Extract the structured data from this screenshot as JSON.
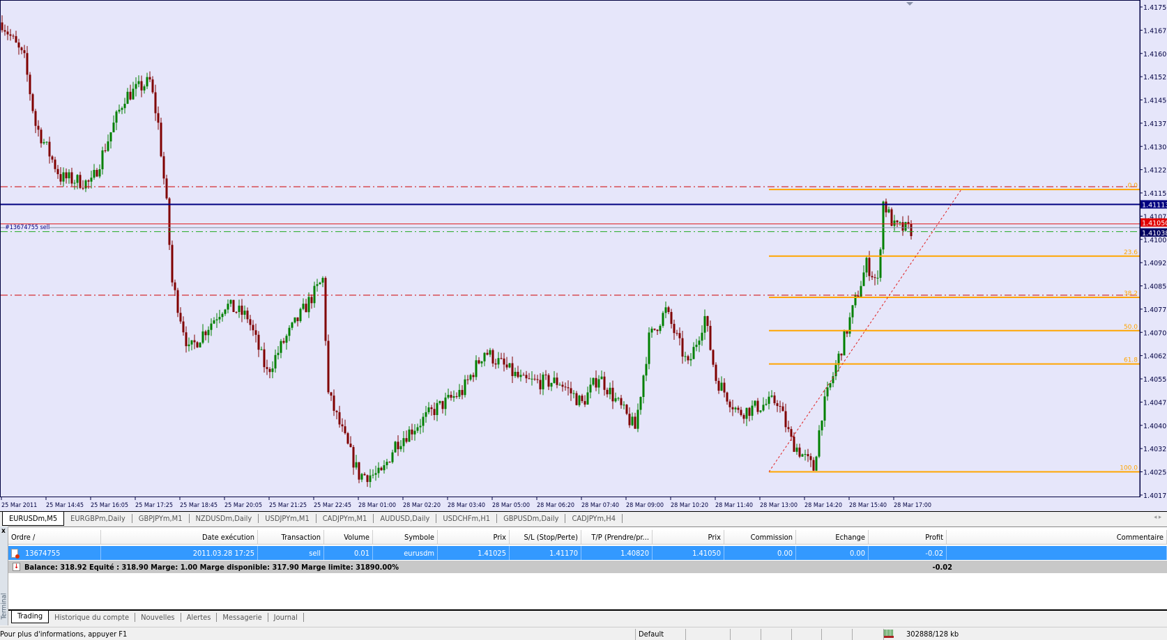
{
  "chart": {
    "symbol": "EURUSDm",
    "timeframe": "M5",
    "order_label": "#13674755 sell",
    "price_labels": {
      "bid": "1.41113",
      "ask": "1.41050",
      "last": "1.41038"
    },
    "colors": {
      "background": "#e6e6fa",
      "bull": "#008000",
      "bear": "#800000",
      "fib": "#ffa500",
      "sl_tp": "#d00000",
      "order": "#22aa22",
      "bid": "#000080"
    }
  },
  "chart_data": {
    "type": "candlestick",
    "y_ticks": [
      "1.41750",
      "1.41675",
      "1.41600",
      "1.41525",
      "1.41450",
      "1.41375",
      "1.41300",
      "1.41225",
      "1.41150",
      "1.41075",
      "1.41000",
      "1.40925",
      "1.40850",
      "1.40775",
      "1.40700",
      "1.40625",
      "1.40550",
      "1.40475",
      "1.40400",
      "1.40325",
      "1.40250",
      "1.40175"
    ],
    "ylim": [
      1.4014,
      1.41775
    ],
    "x_ticks": [
      "25 Mar 2011",
      "25 Mar 14:45",
      "25 Mar 16:05",
      "25 Mar 17:25",
      "25 Mar 18:45",
      "25 Mar 20:05",
      "25 Mar 21:25",
      "25 Mar 22:45",
      "28 Mar 01:00",
      "28 Mar 02:20",
      "28 Mar 03:40",
      "28 Mar 05:00",
      "28 Mar 06:20",
      "28 Mar 07:40",
      "28 Mar 09:00",
      "28 Mar 10:20",
      "28 Mar 11:40",
      "28 Mar 13:00",
      "28 Mar 14:20",
      "28 Mar 15:40",
      "28 Mar 17:00"
    ],
    "bars_per_tick": 16,
    "close_path": [
      [
        0,
        1.417
      ],
      [
        8,
        1.4158
      ],
      [
        12,
        1.4137
      ],
      [
        21,
        1.412
      ],
      [
        32,
        1.4118
      ],
      [
        40,
        1.4137
      ],
      [
        44,
        1.4146
      ],
      [
        53,
        1.4151
      ],
      [
        56,
        1.4137
      ],
      [
        59,
        1.4111
      ],
      [
        61,
        1.4086
      ],
      [
        67,
        1.4064
      ],
      [
        80,
        1.4079
      ],
      [
        88,
        1.4075
      ],
      [
        95,
        1.4057
      ],
      [
        101,
        1.4067
      ],
      [
        115,
        1.4087
      ],
      [
        117,
        1.405
      ],
      [
        124,
        1.4033
      ],
      [
        128,
        1.4024
      ],
      [
        136,
        1.4024
      ],
      [
        141,
        1.4034
      ],
      [
        155,
        1.4045
      ],
      [
        165,
        1.4051
      ],
      [
        173,
        1.4064
      ],
      [
        187,
        1.4054
      ],
      [
        200,
        1.4054
      ],
      [
        208,
        1.4047
      ],
      [
        214,
        1.4056
      ],
      [
        227,
        1.4039
      ],
      [
        232,
        1.4068
      ],
      [
        238,
        1.4077
      ],
      [
        246,
        1.4059
      ],
      [
        252,
        1.4075
      ],
      [
        256,
        1.4055
      ],
      [
        264,
        1.4044
      ],
      [
        278,
        1.4048
      ],
      [
        283,
        1.4035
      ],
      [
        291,
        1.4026
      ],
      [
        294,
        1.4044
      ],
      [
        302,
        1.4068
      ],
      [
        306,
        1.408
      ],
      [
        310,
        1.4092
      ],
      [
        314,
        1.4086
      ],
      [
        316,
        1.4112
      ],
      [
        320,
        1.4104
      ],
      [
        326,
        1.4103
      ]
    ],
    "hlines": [
      {
        "name": "stop-loss",
        "price": 1.4117,
        "style": "dashdot",
        "color": "#d00000"
      },
      {
        "name": "take-profit",
        "price": 1.4082,
        "style": "dashdot",
        "color": "#d00000"
      },
      {
        "name": "bid",
        "price": 1.41113,
        "style": "solid",
        "color": "#000080"
      },
      {
        "name": "ask",
        "price": 1.4105,
        "style": "solid",
        "color": "#e02020"
      },
      {
        "name": "last",
        "price": 1.41038,
        "style": "solid",
        "color": "#8090a0"
      },
      {
        "name": "order-open",
        "price": 1.41025,
        "style": "dashdot",
        "color": "#22aa22"
      }
    ],
    "fibonacci": {
      "high": 1.41161,
      "low": 1.4025,
      "start_bar": 275,
      "levels": [
        {
          "label": "0.0",
          "ratio": 0
        },
        {
          "label": "23.6",
          "ratio": 0.236
        },
        {
          "label": "38.2",
          "ratio": 0.382
        },
        {
          "label": "50.0",
          "ratio": 0.5
        },
        {
          "label": "61.8",
          "ratio": 0.618
        },
        {
          "label": "100.0",
          "ratio": 1
        }
      ]
    },
    "trendline": {
      "from": [
        275,
        1.4025
      ],
      "to": [
        344,
        1.41161
      ]
    }
  },
  "symbol_tabs": [
    "EURUSDm,M5",
    "EURGBPm,Daily",
    "GBPJPYm,M1",
    "NZDUSDm,Daily",
    "USDJPYm,M1",
    "CADJPYm,M1",
    "AUDUSD,Daily",
    "USDCHFm,H1",
    "GBPUSDm,Daily",
    "CADJPYm,H4"
  ],
  "terminal": {
    "side_label": "Terminal",
    "close": "x",
    "columns": [
      "Ordre  /",
      "Date exécution",
      "Transaction",
      "Volume",
      "Symbole",
      "Prix",
      "S/L (Stop/Perte)",
      "T/P (Prendre/pr...",
      "Prix",
      "Commission",
      "Echange",
      "Profit",
      "Commentaire"
    ],
    "order": [
      "13674755",
      "2011.03.28 17:25",
      "sell",
      "0.01",
      "eurusdm",
      "1.41025",
      "1.41170",
      "1.40820",
      "1.41050",
      "0.00",
      "0.00",
      "-0.02",
      ""
    ],
    "balance_text": "Balance: 318.92  Equité : 318.90  Marge: 1.00  Marge disponible: 317.90  Marge limite: 31890.00%",
    "total_profit": "-0.02",
    "tabs": [
      "Trading",
      "Historique du compte",
      "Nouvelles",
      "Alertes",
      "Messagerie",
      "Journal"
    ]
  },
  "status": {
    "help": "Pour plus d'informations, appuyer F1",
    "profile": "Default",
    "traffic": "302888/128 kb"
  }
}
